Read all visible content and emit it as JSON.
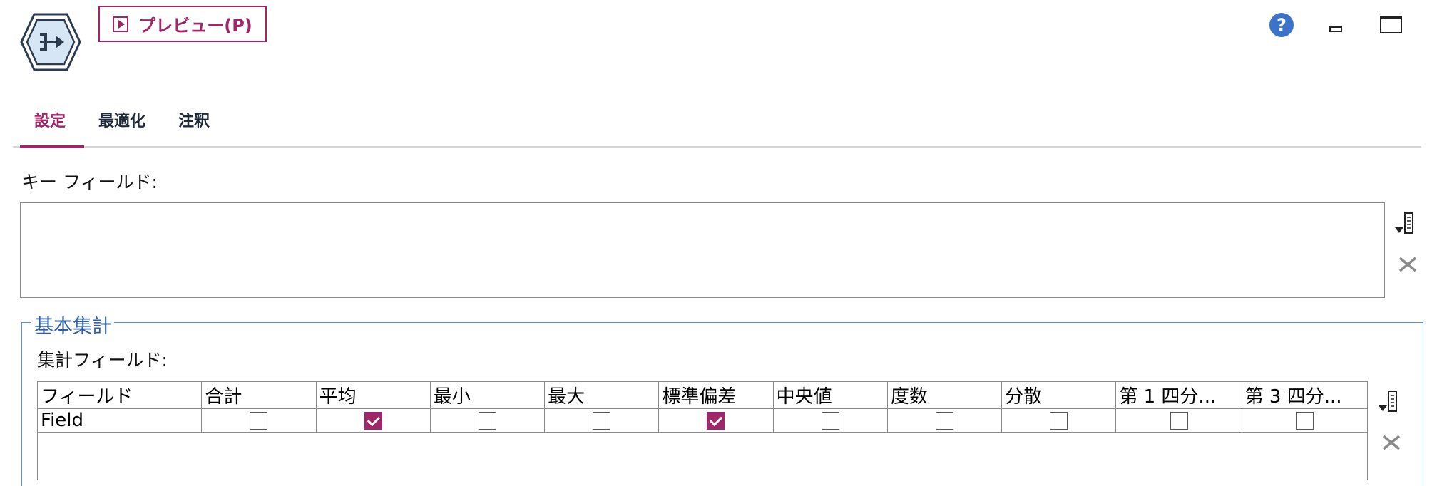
{
  "header": {
    "preview_label": "プレビュー(P)",
    "node_icon": "aggregate-node-icon",
    "help_icon": "help-icon",
    "help_glyph": "?"
  },
  "tabs": [
    {
      "label": "設定",
      "active": true
    },
    {
      "label": "最適化",
      "active": false
    },
    {
      "label": "注釈",
      "active": false
    }
  ],
  "key_fields": {
    "label": "キー フィールド:",
    "values": []
  },
  "basic_aggregates": {
    "group_title": "基本集計",
    "fields_label": "集計フィールド:",
    "columns": [
      "フィールド",
      "合計",
      "平均",
      "最小",
      "最大",
      "標準偏差",
      "中央値",
      "度数",
      "分散",
      "第 1 四分...",
      "第 3 四分..."
    ],
    "rows": [
      {
        "field": "Field",
        "checks": [
          false,
          true,
          false,
          false,
          true,
          false,
          false,
          false,
          false,
          false
        ]
      }
    ]
  },
  "colors": {
    "accent": "#a0266a",
    "group_border": "#5b8fd2",
    "help": "#3d72c9"
  }
}
